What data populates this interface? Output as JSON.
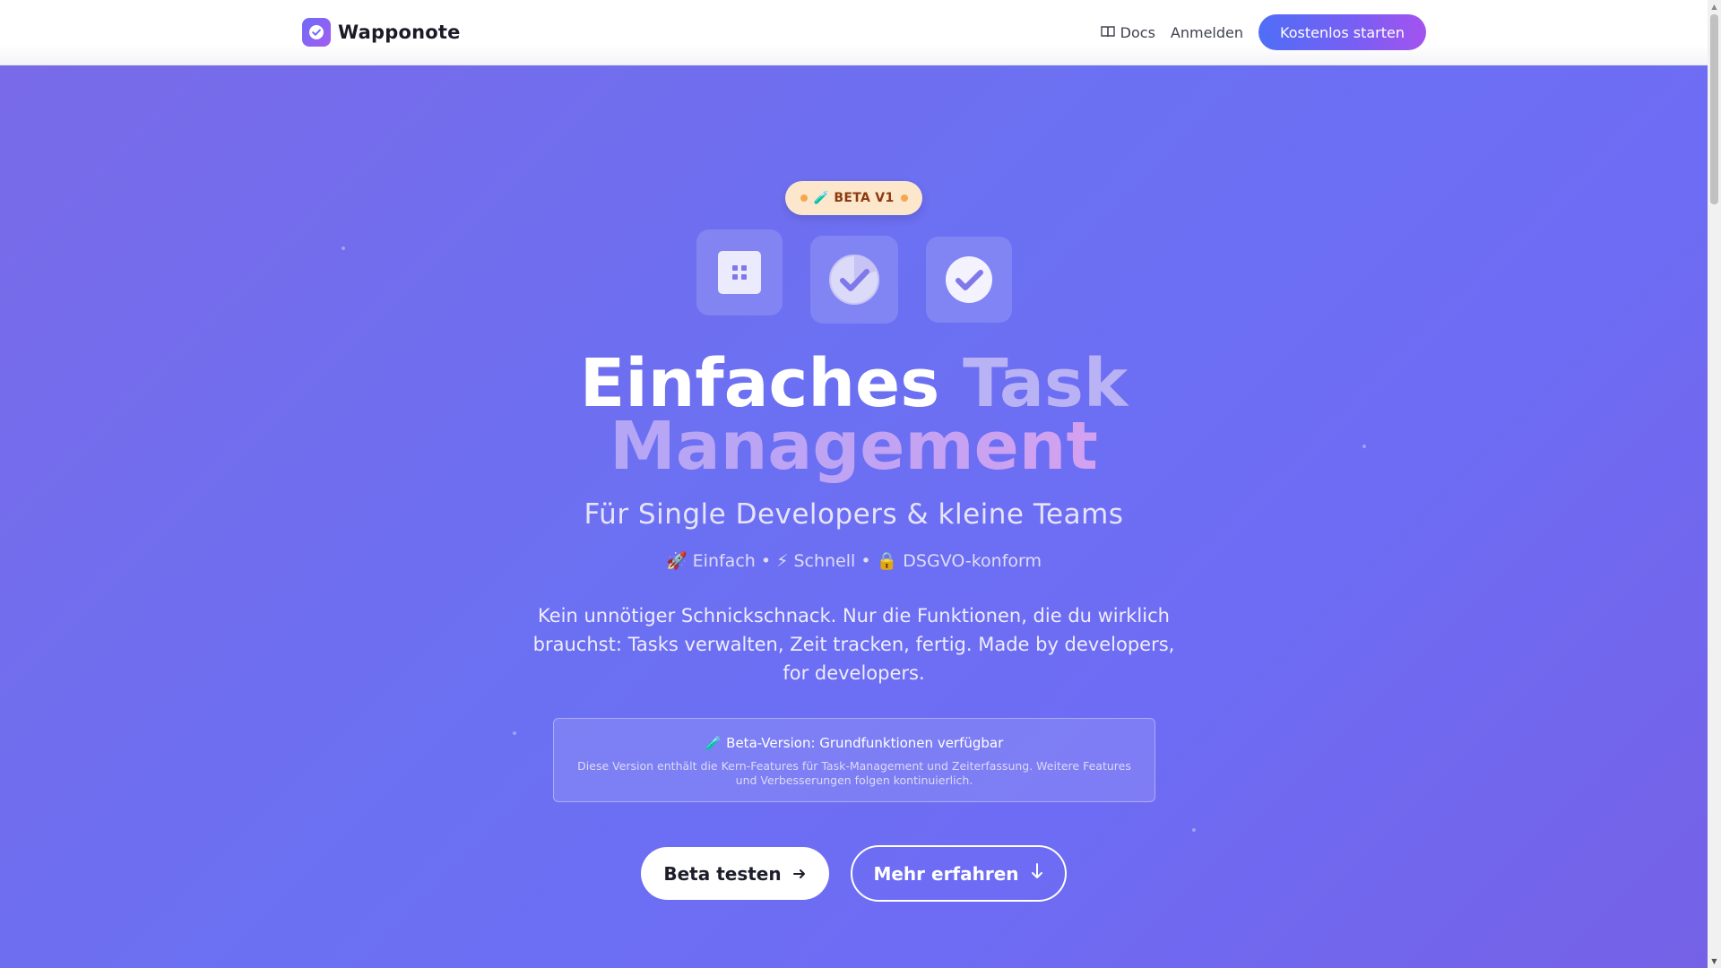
{
  "header": {
    "brand_name": "Wapponote",
    "brand_icon": "check-circle-icon",
    "nav": {
      "docs_label": "Docs",
      "docs_icon": "book-icon",
      "login_label": "Anmelden",
      "cta_label": "Kostenlos starten"
    }
  },
  "hero": {
    "badge_label": "🧪 BETA V1",
    "feature_icons": [
      "grid-icon",
      "clock-check-icon",
      "check-circle-icon"
    ],
    "title_line1_a": "Einfaches",
    "title_line1_b": "Task",
    "title_line2": "Management",
    "subtitle": "Für Single Developers & kleine Teams",
    "tagline": "🚀 Einfach • ⚡ Schnell • 🔒 DSGVO-konform",
    "description": "Kein unnötiger Schnickschnack. Nur die Funktionen, die du wirklich brauchst: Tasks verwalten, Zeit tracken, fertig. Made by developers, for developers.",
    "info_title": "🧪 Beta-Version: Grundfunktionen verfügbar",
    "info_text": "Diese Version enthält die Kern-Features für Task-Management und Zeiterfassung. Weitere Features und Verbesserungen folgen kontinuierlich.",
    "primary_button": "Beta testen",
    "secondary_button": "Mehr erfahren"
  },
  "colors": {
    "background_start": "#7a6ae8",
    "background_end": "#6b70f2",
    "cta_gradient_start": "#4f6ef6",
    "cta_gradient_end": "#a453ee",
    "badge_bg": "#fde7cc",
    "badge_text": "#8a3a0f"
  }
}
